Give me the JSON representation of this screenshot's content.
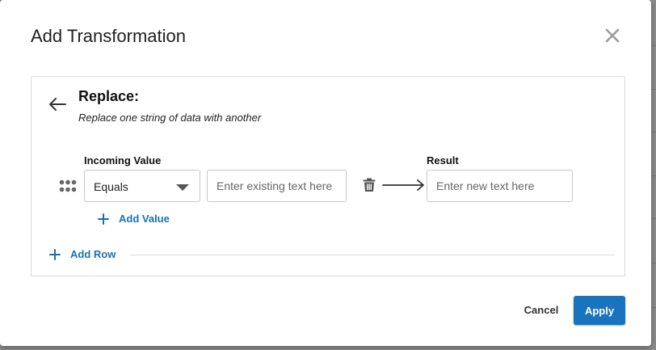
{
  "modal": {
    "title": "Add Transformation"
  },
  "panel": {
    "title": "Replace:",
    "subtitle": "Replace one string of data with another"
  },
  "row": {
    "incoming_label": "Incoming Value",
    "result_label": "Result",
    "match_select": {
      "value": "Equals"
    },
    "existing_input": {
      "value": "",
      "placeholder": "Enter existing text here"
    },
    "result_input": {
      "value": "",
      "placeholder": "Enter new text here"
    }
  },
  "actions": {
    "add_value": "Add Value",
    "add_row": "Add Row",
    "cancel": "Cancel",
    "apply": "Apply"
  },
  "icons": {
    "close": "close-icon",
    "back": "arrow-left-icon",
    "drag": "drag-handle-icon",
    "caret": "caret-down-icon",
    "trash": "trash-icon",
    "arrow": "arrow-right-icon",
    "plus": "plus-icon"
  },
  "colors": {
    "accent": "#1a73be",
    "link": "#1a6fb5",
    "backdrop": "#8c8c8c"
  }
}
